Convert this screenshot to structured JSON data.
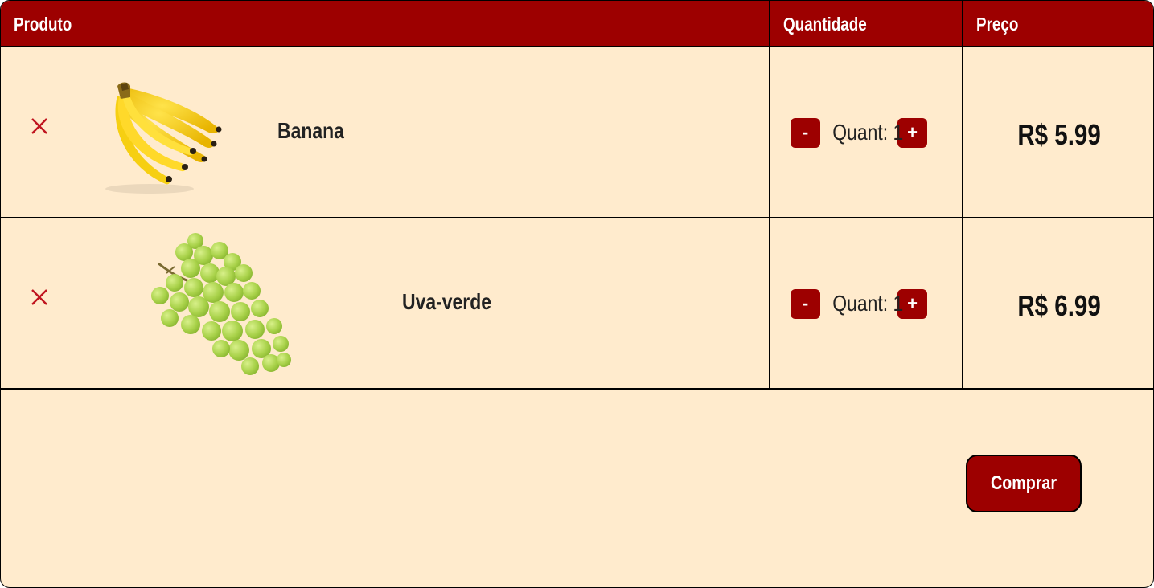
{
  "table": {
    "headers": {
      "product": "Produto",
      "quantity": "Quantidade",
      "price": "Preço"
    },
    "rows": [
      {
        "name": "Banana",
        "quantity_text": "Quant: 1",
        "minus_label": "-",
        "plus_label": "+",
        "price": "R$ 5.99",
        "image_icon": "banana-image"
      },
      {
        "name": "Uva-verde",
        "quantity_text": "Quant: 1",
        "minus_label": "-",
        "plus_label": "+",
        "price": "R$ 6.99",
        "image_icon": "green-grapes-image"
      }
    ]
  },
  "buy_button_label": "Comprar",
  "colors": {
    "accent": "#9d0000",
    "background": "#ffebcd",
    "remove_icon": "#c0141e"
  }
}
